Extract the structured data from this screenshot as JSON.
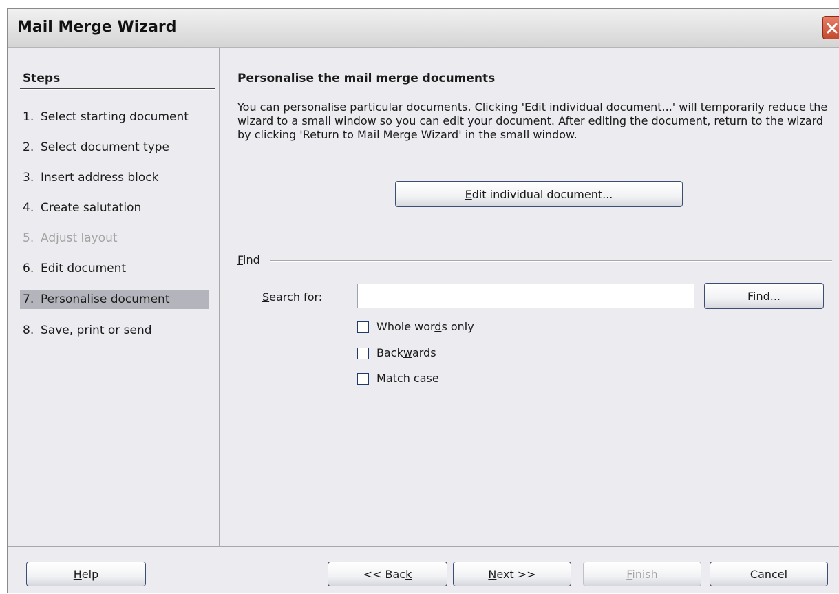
{
  "window": {
    "title": "Mail Merge Wizard"
  },
  "sidebar": {
    "heading": "Steps",
    "steps": [
      {
        "num": "1.",
        "label": "Select starting document",
        "state": "normal"
      },
      {
        "num": "2.",
        "label": "Select document type",
        "state": "normal"
      },
      {
        "num": "3.",
        "label": "Insert address block",
        "state": "normal"
      },
      {
        "num": "4.",
        "label": "Create salutation",
        "state": "normal"
      },
      {
        "num": "5.",
        "label": "Adjust layout",
        "state": "disabled"
      },
      {
        "num": "6.",
        "label": "Edit document",
        "state": "normal"
      },
      {
        "num": "7.",
        "label": "Personalise document",
        "state": "selected"
      },
      {
        "num": "8.",
        "label": "Save, print or send",
        "state": "normal"
      }
    ]
  },
  "main": {
    "heading": "Personalise the mail merge documents",
    "description": "You can personalise particular documents. Clicking 'Edit individual document...' will temporarily reduce the wizard to a small window so you can edit your document. After editing the document, return to the wizard by clicking 'Return to Mail Merge Wizard' in the small window.",
    "edit_button": {
      "pre": "",
      "key": "E",
      "post": "dit individual document..."
    },
    "find": {
      "group": {
        "pre": "",
        "key": "F",
        "post": "ind"
      },
      "search_label": {
        "pre": "",
        "key": "S",
        "post": "earch for:"
      },
      "search_value": "",
      "find_button": {
        "pre": "",
        "key": "F",
        "post": "ind..."
      },
      "options": [
        {
          "pre": "Whole wor",
          "key": "d",
          "post": "s only",
          "checked": false
        },
        {
          "pre": "Back",
          "key": "w",
          "post": "ards",
          "checked": false
        },
        {
          "pre": "M",
          "key": "a",
          "post": "tch case",
          "checked": false
        }
      ]
    }
  },
  "buttons": {
    "help": {
      "pre": "",
      "key": "H",
      "post": "elp"
    },
    "back": {
      "pre": "<< Bac",
      "key": "k",
      "post": ""
    },
    "next": {
      "pre": "",
      "key": "N",
      "post": "ext >>"
    },
    "finish": {
      "pre": "",
      "key": "F",
      "post": "inish"
    },
    "cancel": {
      "pre": "Cancel",
      "key": "",
      "post": ""
    }
  }
}
